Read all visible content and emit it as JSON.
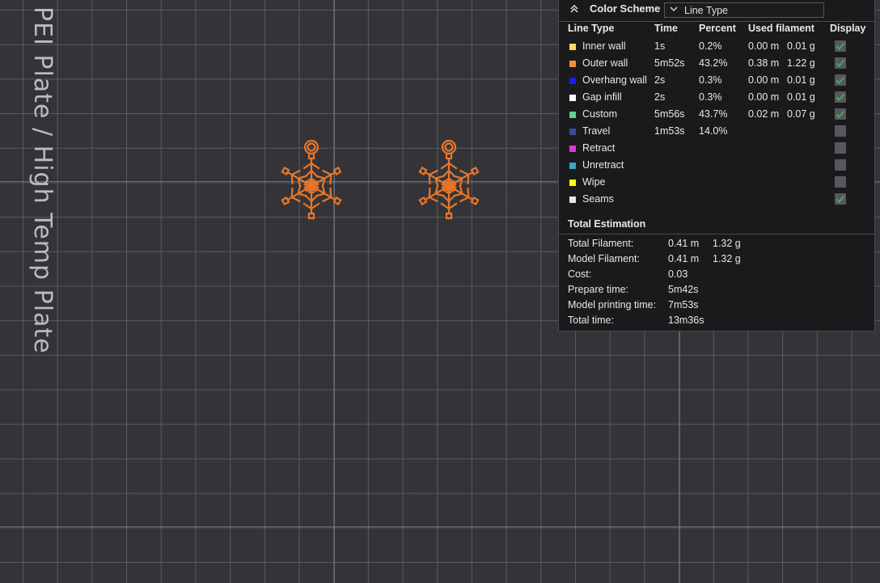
{
  "plate": {
    "label": "PEI Plate / High Temp Plate"
  },
  "legend": {
    "collapse_icon": "double-chevron-up-icon",
    "title": "Color Scheme",
    "scheme_value": "Line Type",
    "columns": {
      "line_type": "Line Type",
      "time": "Time",
      "percent": "Percent",
      "used_filament": "Used filament",
      "display": "Display"
    },
    "rows": [
      {
        "name": "Inner wall",
        "color": "#FFD95A",
        "time": "1s",
        "percent": "0.2%",
        "meters": "0.00 m",
        "grams": "0.01 g",
        "display": true
      },
      {
        "name": "Outer wall",
        "color": "#FF8A3D",
        "time": "5m52s",
        "percent": "43.2%",
        "meters": "0.38 m",
        "grams": "1.22 g",
        "display": true
      },
      {
        "name": "Overhang wall",
        "color": "#1A1AFF",
        "time": "2s",
        "percent": "0.3%",
        "meters": "0.00 m",
        "grams": "0.01 g",
        "display": true
      },
      {
        "name": "Gap infill",
        "color": "#FFFFFF",
        "time": "2s",
        "percent": "0.3%",
        "meters": "0.00 m",
        "grams": "0.01 g",
        "display": true
      },
      {
        "name": "Custom",
        "color": "#5ED193",
        "time": "5m56s",
        "percent": "43.7%",
        "meters": "0.02 m",
        "grams": "0.07 g",
        "display": true
      },
      {
        "name": "Travel",
        "color": "#3A4A9C",
        "time": "1m53s",
        "percent": "14.0%",
        "meters": "",
        "grams": "",
        "display": false
      },
      {
        "name": "Retract",
        "color": "#D63BD6",
        "time": "",
        "percent": "",
        "meters": "",
        "grams": "",
        "display": false
      },
      {
        "name": "Unretract",
        "color": "#3AA6C8",
        "time": "",
        "percent": "",
        "meters": "",
        "grams": "",
        "display": false
      },
      {
        "name": "Wipe",
        "color": "#FFFF00",
        "time": "",
        "percent": "",
        "meters": "",
        "grams": "",
        "display": false
      },
      {
        "name": "Seams",
        "color": "#E6E6E6",
        "time": "",
        "percent": "",
        "meters": "",
        "grams": "",
        "display": true
      }
    ],
    "total": {
      "title": "Total Estimation",
      "total_filament": {
        "label": "Total Filament:",
        "meters": "0.41 m",
        "grams": "1.32 g"
      },
      "model_filament": {
        "label": "Model Filament:",
        "meters": "0.41 m",
        "grams": "1.32 g"
      },
      "cost": {
        "label": "Cost:",
        "value": "0.03"
      },
      "prepare_time": {
        "label": "Prepare time:",
        "value": "5m42s"
      },
      "model_printing_time": {
        "label": "Model printing time:",
        "value": "7m53s"
      },
      "total_time": {
        "label": "Total time:",
        "value": "13m36s"
      }
    }
  },
  "models": [
    {
      "name": "snowflake-ornament-1",
      "color": "#E8762A"
    },
    {
      "name": "snowflake-ornament-2",
      "color": "#E8762A"
    }
  ],
  "colors": {
    "check": "#3FAE5A",
    "background": "#343438"
  }
}
